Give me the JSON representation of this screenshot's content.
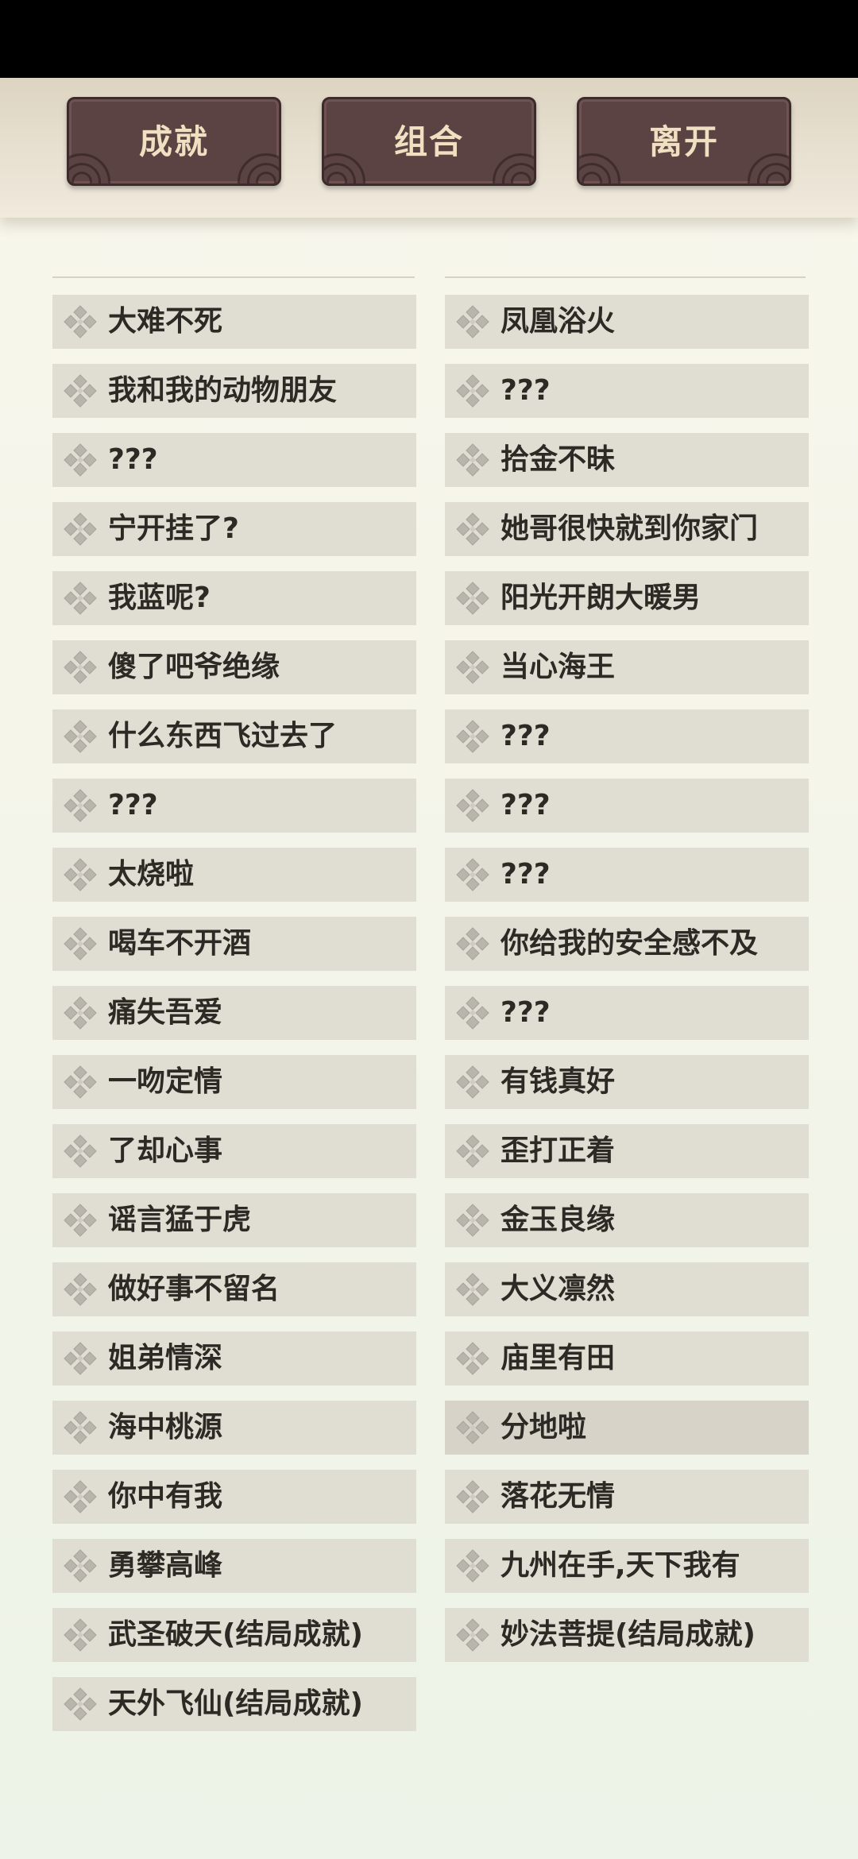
{
  "header": {
    "buttons": [
      {
        "label": "成就"
      },
      {
        "label": "组合"
      },
      {
        "label": "离开"
      }
    ]
  },
  "achievements": {
    "left": [
      "大难不死",
      "我和我的动物朋友",
      "???",
      "宁开挂了?",
      "我蓝呢?",
      "傻了吧爷绝缘",
      "什么东西飞过去了",
      "???",
      "太烧啦",
      "喝车不开酒",
      "痛失吾爱",
      "一吻定情",
      "了却心事",
      "谣言猛于虎",
      "做好事不留名",
      "姐弟情深",
      "海中桃源",
      "你中有我",
      "勇攀高峰",
      "武圣破天(结局成就)",
      "天外飞仙(结局成就)"
    ],
    "right": [
      "凤凰浴火",
      "???",
      "拾金不昧",
      "她哥很快就到你家门",
      "阳光开朗大暖男",
      "当心海王",
      "???",
      "???",
      "???",
      "你给我的安全感不及",
      "???",
      "有钱真好",
      "歪打正着",
      "金玉良缘",
      "大义凛然",
      "庙里有田",
      "分地啦",
      "落花无情",
      "九州在手,天下我有",
      "妙法菩提(结局成就)"
    ]
  },
  "icons": {
    "achievement": "diamond-cluster-icon"
  },
  "colors": {
    "button_bg": "#5c4343",
    "button_text": "#f1dfc1",
    "row_bg": "#e0ddd2",
    "row_text": "#2d2a26",
    "icon": "#b9b5ad"
  }
}
